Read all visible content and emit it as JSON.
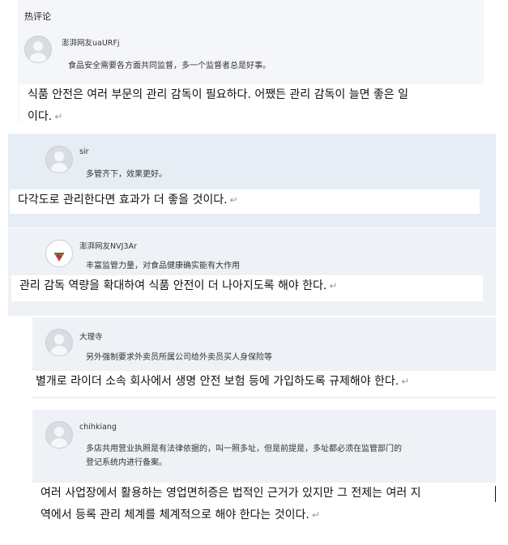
{
  "section_title": "热评论",
  "comments": [
    {
      "user": "澎湃网友uaURFj",
      "text": "食品安全需要各方面共同监督，多一个监督者总是好事。",
      "translation_line1": "식품 안전은 여러 부문의 관리 감독이 필요하다. 어쨌든 관리 감독이 늘면 좋은 일",
      "translation_line2": "이다.",
      "avatar": "default-avatar-icon"
    },
    {
      "user": "sir",
      "text": "多管齐下，效果更好。",
      "translation": "다각도로 관리한다면 효과가 더 좋을 것이다.",
      "avatar": "default-avatar-icon"
    },
    {
      "user": "澎湃网友NVJ3Ar",
      "text": "丰富监管力量，对食品健康确实能有大作用",
      "translation": "관리 감독 역량을 확대하여 식품 안전이 더 나아지도록 해야 한다.",
      "avatar": "watermelon-icon"
    },
    {
      "user": "大理寺",
      "text": "另外强制要求外卖员所属公司给外卖员买人身保险等",
      "translation": "별개로 라이더 소속 회사에서 생명 안전 보험 등에 가입하도록 규제해야 한다.",
      "avatar": "default-avatar-icon"
    },
    {
      "user": "chihkiang",
      "text_line1": "多店共用营业执照是有法律依据的，叫一照多址，但是前提是，多址都必须在监管部门的",
      "text_line2": "登记系统内进行备案。",
      "translation_line1": "여러 사업장에서 활용하는 영업면허증은 법적인 근거가 있지만 그 전제는 여러 지",
      "translation_line2": "역에서 등록 관리 체계를 체계적으로 해야 한다는 것이다.",
      "avatar": "default-avatar-icon"
    }
  ],
  "return_mark": "↵"
}
